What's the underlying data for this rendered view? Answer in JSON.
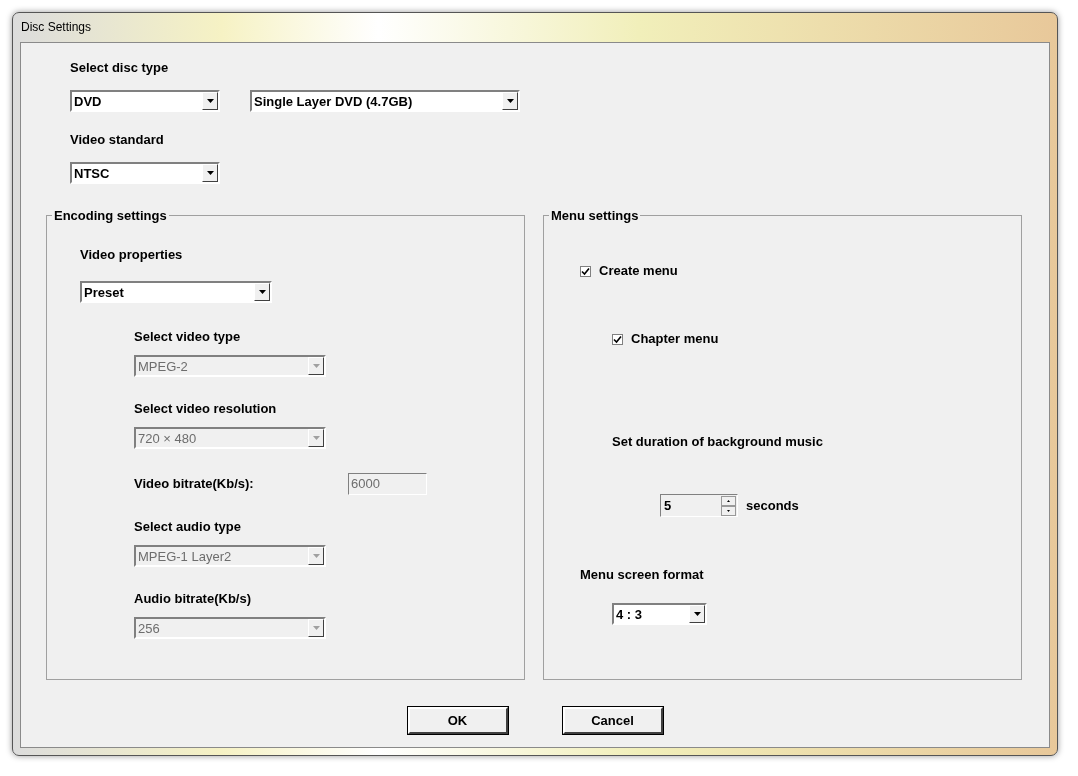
{
  "window": {
    "title": "Disc Settings"
  },
  "disc": {
    "label": "Select disc type",
    "type_combo": {
      "value": "DVD",
      "disabled": false
    },
    "size_combo": {
      "value": "Single Layer DVD (4.7GB)",
      "disabled": false
    }
  },
  "video_standard": {
    "label": "Video standard",
    "combo": {
      "value": "NTSC",
      "disabled": false
    }
  },
  "encoding": {
    "title": "Encoding settings",
    "properties_label": "Video properties",
    "properties_combo": {
      "value": "Preset",
      "disabled": false
    },
    "fields": [
      {
        "kind": "combo",
        "label": "Select video type",
        "value": "MPEG-2",
        "disabled": true
      },
      {
        "kind": "combo",
        "label": "Select video resolution",
        "value": "720 × 480",
        "disabled": true
      },
      {
        "kind": "text",
        "label": "Video bitrate(Kb/s):",
        "value": "6000",
        "disabled": true
      },
      {
        "kind": "combo",
        "label": "Select audio type",
        "value": "MPEG-1 Layer2",
        "disabled": true
      },
      {
        "kind": "combo",
        "label": "Audio bitrate(Kb/s)",
        "value": "256",
        "disabled": true
      }
    ]
  },
  "menu": {
    "title": "Menu settings",
    "create_menu": {
      "label": "Create menu",
      "checked": true
    },
    "chapter_menu": {
      "label": "Chapter menu",
      "checked": true
    },
    "duration_label": "Set duration of background music",
    "duration": {
      "value": "5",
      "unit": "seconds"
    },
    "format_label": "Menu screen format",
    "format_combo": {
      "value": "4 : 3",
      "disabled": false
    }
  },
  "buttons": [
    "OK",
    "Cancel"
  ]
}
